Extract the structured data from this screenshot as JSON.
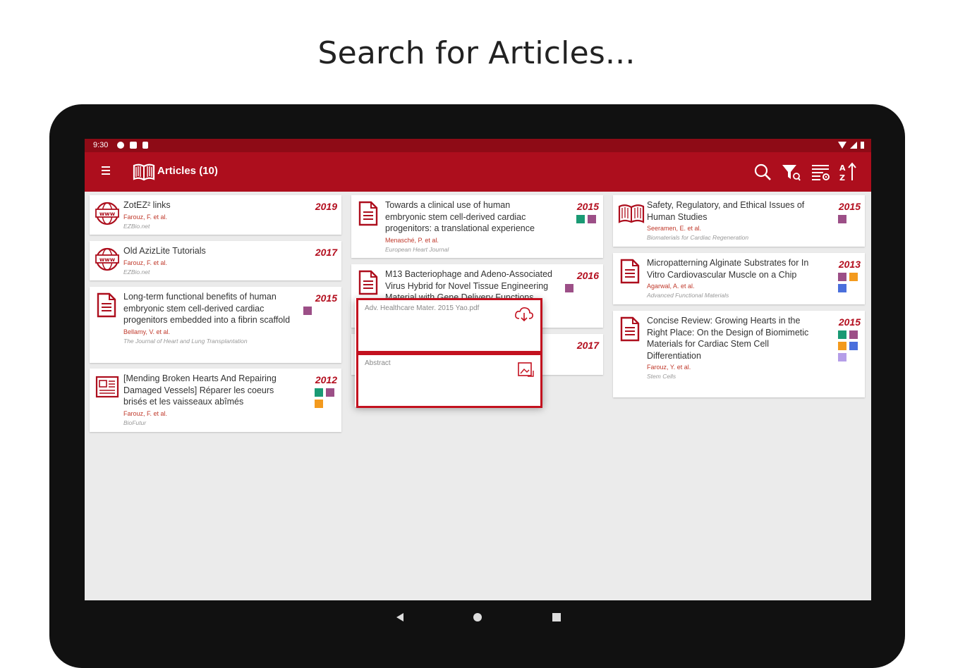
{
  "headline": "Search for Articles...",
  "status_bar": {
    "time": "9:30"
  },
  "app_bar": {
    "title": "Articles (10)",
    "menu_icon": "hamburger-icon",
    "logo_icon": "open-book-icon",
    "tools": [
      "search-icon",
      "filter-icon",
      "view-settings-icon",
      "sort-icon"
    ]
  },
  "colors": {
    "brand": "#ad0e1d",
    "status_bar": "#8e0b16",
    "year": "#b30e1e",
    "author": "#c0392b",
    "tag_teal": "#1a9a74",
    "tag_purple": "#9c4f87",
    "tag_orange": "#f39a1e",
    "tag_blue": "#4a6fdc",
    "tag_lavender": "#b59ee8"
  },
  "columns": [
    [
      {
        "icon": "web-page-icon",
        "title": "ZotEZ² links",
        "authors": "Farouz, F. et al.",
        "journal": "EZBio.net",
        "year": "2019",
        "tags": []
      },
      {
        "icon": "web-page-icon",
        "title": "Old AzizLite Tutorials",
        "authors": "Farouz, F. et al.",
        "journal": "EZBio.net",
        "year": "2017",
        "tags": []
      },
      {
        "icon": "document-icon",
        "title": "Long-term functional benefits of human embryonic stem cell-derived cardiac progenitors embedded into a fibrin scaffold",
        "authors": "Bellamy, V. et al.",
        "journal": "The Journal of Heart and Lung Transplantation",
        "year": "2015",
        "tags": [
          "#9c4f87"
        ]
      },
      {
        "icon": "newspaper-icon",
        "title": "[Mending Broken Hearts And Repairing Damaged Vessels] Réparer les coeurs brisés et les vaisseaux abîmés",
        "authors": "Farouz, F. et al.",
        "journal": "BioFutur",
        "year": "2012",
        "tags": [
          "#1a9a74",
          "#9c4f87",
          "#f39a1e"
        ]
      }
    ],
    [
      {
        "icon": "document-icon",
        "title": "Towards a clinical use of human embryonic stem cell-derived cardiac progenitors: a translational experience",
        "authors": "Menasché, P. et al.",
        "journal": "European Heart Journal",
        "year": "2015",
        "tags": [
          "#1a9a74",
          "#9c4f87"
        ]
      },
      {
        "icon": "document-icon",
        "title": "M13 Bacteriophage and Adeno-Associated Virus Hybrid for Novel Tissue Engineering Material with Gene Delivery Functions",
        "authors": "",
        "journal": "",
        "year": "2016",
        "tags": [
          "#9c4f87"
        ]
      },
      {
        "icon": "document-icon",
        "title": "",
        "authors": "",
        "journal": "",
        "year": "2017",
        "tags": []
      }
    ],
    [
      {
        "icon": "book-icon",
        "title": "Safety, Regulatory, and Ethical Issues of Human Studies",
        "authors": "Seeramen, E. et al.",
        "journal": "Biomaterials for Cardiac Regeneration",
        "year": "2015",
        "tags": [
          "#9c4f87"
        ]
      },
      {
        "icon": "document-icon",
        "title": "Micropatterning Alginate Substrates for In Vitro Cardiovascular Muscle on a Chip",
        "authors": "Agarwal, A. et al.",
        "journal": "Advanced Functional Materials",
        "year": "2013",
        "tags": [
          "#9c4f87",
          "#f39a1e",
          "#4a6fdc"
        ]
      },
      {
        "icon": "document-icon",
        "title": "Concise Review: Growing Hearts in the Right Place: On the Design of Biomimetic Materials for Cardiac Stem Cell Differentiation",
        "authors": "Farouz, Y. et al.",
        "journal": "Stem Cells",
        "year": "2015",
        "tags": [
          "#1a9a74",
          "#9c4f87",
          "#f39a1e",
          "#4a6fdc",
          "#b59ee8"
        ]
      }
    ]
  ],
  "popup": {
    "pdf_label": "Adv. Healthcare Mater. 2015 Yao.pdf",
    "pdf_action_icon": "cloud-download-icon",
    "abstract_label": "Abstract",
    "abstract_action_icon": "abstract-image-icon"
  },
  "nav_bar": [
    "back-icon",
    "home-icon",
    "recents-icon"
  ]
}
